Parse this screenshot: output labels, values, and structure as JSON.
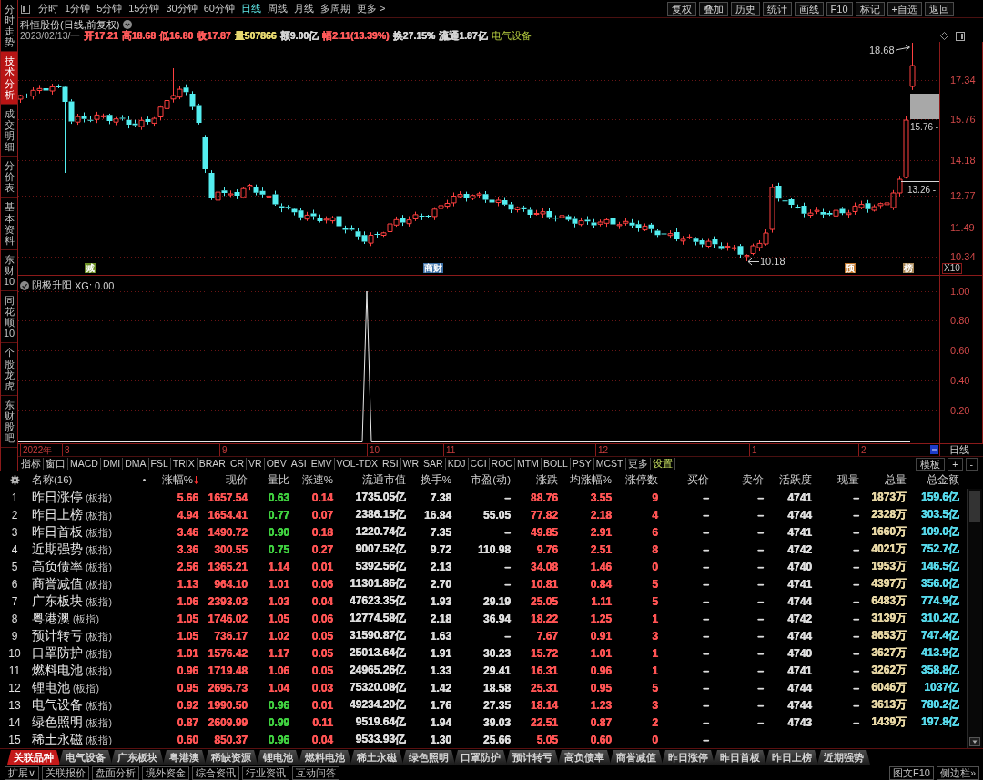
{
  "sidebar": {
    "tabs": [
      {
        "label": "分时走势",
        "selected": false
      },
      {
        "label": "技术分析",
        "selected": true
      },
      {
        "label": "成交明细",
        "selected": false
      },
      {
        "label": "分价表",
        "selected": false
      },
      {
        "label": "基本资料",
        "selected": false
      },
      {
        "label": "东财10",
        "selected": false
      },
      {
        "label": "同花顺10",
        "selected": false
      },
      {
        "label": "个股龙虎",
        "selected": false
      },
      {
        "label": "东财股吧",
        "selected": false
      }
    ]
  },
  "toolbar": {
    "periods": [
      {
        "label": "分时",
        "selected": false
      },
      {
        "label": "1分钟",
        "selected": false
      },
      {
        "label": "5分钟",
        "selected": false
      },
      {
        "label": "15分钟",
        "selected": false
      },
      {
        "label": "30分钟",
        "selected": false
      },
      {
        "label": "60分钟",
        "selected": false
      },
      {
        "label": "日线",
        "selected": true
      },
      {
        "label": "周线",
        "selected": false
      },
      {
        "label": "月线",
        "selected": false
      },
      {
        "label": "多周期",
        "selected": false
      },
      {
        "label": "更多 >",
        "selected": false
      }
    ],
    "actions": [
      "复权",
      "叠加",
      "历史",
      "统计",
      "画线",
      "F10",
      "标记",
      "+自选",
      "返回"
    ]
  },
  "quote": {
    "title": "科恒股份(日线,前复权)",
    "date": "2023/02/13/一",
    "fields": [
      {
        "text": "开17.21",
        "color": "#ff5a5a"
      },
      {
        "text": "高18.68",
        "color": "#ff5a5a"
      },
      {
        "text": "低16.80",
        "color": "#ff5a5a"
      },
      {
        "text": "收17.87",
        "color": "#ff5a5a"
      },
      {
        "text": "量507866",
        "color": "#e6d870"
      },
      {
        "text": "额9.00亿",
        "color": "#d4d4d4"
      },
      {
        "text": "幅2.11(13.39%)",
        "color": "#ff5a5a"
      },
      {
        "text": "换27.15%",
        "color": "#d4d4d4"
      },
      {
        "text": "流通1.87亿",
        "color": "#d4d4d4"
      }
    ],
    "sector": "电气设备"
  },
  "price_chart": {
    "axis_labels": [
      "17.34",
      "15.76",
      "14.18",
      "12.77",
      "11.49",
      "10.34"
    ],
    "annotations": [
      {
        "text": "18.68"
      },
      {
        "text": "15.76 -"
      },
      {
        "text": "13.26 -"
      },
      {
        "text": "10.18"
      }
    ],
    "markers": [
      {
        "text": "减",
        "color": "#6b8e23"
      },
      {
        "text": "商财",
        "color": "#3a6ea5"
      },
      {
        "text": "预",
        "color": "#c0762a"
      },
      {
        "text": "榜",
        "color": "#a88858"
      }
    ],
    "scale_button": "X10"
  },
  "indicator": {
    "title": "阴极升阳",
    "reading": "XG: 0.00",
    "axis_labels": [
      "1.00",
      "0.80",
      "0.60",
      "0.40",
      "0.20"
    ]
  },
  "date_axis": {
    "labels": [
      "2022年",
      "8",
      "9",
      "10",
      "11",
      "12",
      "1",
      "2"
    ],
    "period": "日线"
  },
  "indicator_tabs": {
    "items": [
      "指标",
      "窗口",
      "MACD",
      "DMI",
      "DMA",
      "FSL",
      "TRIX",
      "BRAR",
      "CR",
      "VR",
      "OBV",
      "ASI",
      "EMV",
      "VOL-TDX",
      "RSI",
      "WR",
      "SAR",
      "KDJ",
      "CCI",
      "ROC",
      "MTM",
      "BOLL",
      "PSY",
      "MCST",
      "更多"
    ],
    "settings": "设置",
    "right": [
      "模板",
      "+",
      "-"
    ]
  },
  "table": {
    "name_header": "名称(16)",
    "columns": [
      {
        "label": "涨幅%",
        "color": "#ff5454",
        "sorted": true
      },
      {
        "label": "现价",
        "color": "#ff5454",
        "sorted": false
      },
      {
        "label": "量比",
        "sorted": false
      },
      {
        "label": "涨速%",
        "color": "#ff5454",
        "sorted": false
      },
      {
        "label": "流通市值",
        "color": "#dcdcdc",
        "sorted": false
      },
      {
        "label": "换手%",
        "color": "#dcdcdc",
        "sorted": false
      },
      {
        "label": "市盈(动)",
        "color": "#dcdcdc",
        "sorted": false
      },
      {
        "label": "涨跌",
        "color": "#ff5454",
        "sorted": false
      },
      {
        "label": "均涨幅%",
        "color": "#ff5454",
        "sorted": false
      },
      {
        "label": "涨停数",
        "color": "#ff5454",
        "sorted": false
      },
      {
        "label": "买价",
        "color": "#dcdcdc",
        "sorted": false
      },
      {
        "label": "卖价",
        "color": "#dcdcdc",
        "sorted": false
      },
      {
        "label": "活跃度",
        "color": "#dcdcdc",
        "sorted": false
      },
      {
        "label": "现量",
        "color": "#dcdcdc",
        "sorted": false
      },
      {
        "label": "总量",
        "color": "#e6d6a4",
        "sorted": false
      },
      {
        "label": "总金额",
        "color": "#56d8ea",
        "sorted": false
      }
    ],
    "rows": [
      {
        "index": "1",
        "name": "昨日涨停",
        "tag": "(板指)",
        "cells": [
          "5.66",
          "1657.54",
          {
            "text": "0.63",
            "color": "#40d040"
          },
          "0.14",
          "1735.05亿",
          "7.38",
          "–",
          "88.76",
          "3.55",
          "9",
          "–",
          "–",
          "4741",
          "–",
          "1873万",
          "159.6亿"
        ]
      },
      {
        "index": "2",
        "name": "昨日上榜",
        "tag": "(板指)",
        "cells": [
          "4.94",
          "1654.41",
          {
            "text": "0.77",
            "color": "#40d040"
          },
          "0.07",
          "2386.15亿",
          "16.84",
          "55.05",
          "77.82",
          "2.18",
          "4",
          "–",
          "–",
          "4744",
          "–",
          "2328万",
          "303.5亿"
        ]
      },
      {
        "index": "3",
        "name": "昨日首板",
        "tag": "(板指)",
        "cells": [
          "3.46",
          "1490.72",
          {
            "text": "0.90",
            "color": "#40d040"
          },
          "0.18",
          "1220.74亿",
          "7.35",
          "–",
          "49.85",
          "2.91",
          "6",
          "–",
          "–",
          "4741",
          "–",
          "1660万",
          "109.0亿"
        ]
      },
      {
        "index": "4",
        "name": "近期强势",
        "tag": "(板指)",
        "cells": [
          "3.36",
          "300.55",
          {
            "text": "0.75",
            "color": "#40d040"
          },
          "0.27",
          "9007.52亿",
          "9.72",
          "110.98",
          "9.76",
          "2.51",
          "8",
          "–",
          "–",
          "4742",
          "–",
          "4021万",
          "752.7亿"
        ]
      },
      {
        "index": "5",
        "name": "高负债率",
        "tag": "(板指)",
        "cells": [
          "2.56",
          "1365.21",
          {
            "text": "1.14",
            "color": "#ff5454"
          },
          "0.01",
          "5392.56亿",
          "2.13",
          "–",
          "34.08",
          "1.46",
          "0",
          "–",
          "–",
          "4740",
          "–",
          "1953万",
          "146.5亿"
        ]
      },
      {
        "index": "6",
        "name": "商誉减值",
        "tag": "(板指)",
        "cells": [
          "1.13",
          "964.10",
          {
            "text": "1.01",
            "color": "#ff5454"
          },
          "0.06",
          "11301.86亿",
          "2.70",
          "–",
          "10.81",
          "0.84",
          "5",
          "–",
          "–",
          "4741",
          "–",
          "4397万",
          "356.0亿"
        ]
      },
      {
        "index": "7",
        "name": "广东板块",
        "tag": "(板指)",
        "cells": [
          "1.06",
          "2393.03",
          {
            "text": "1.03",
            "color": "#ff5454"
          },
          "0.04",
          "47623.35亿",
          "1.93",
          "29.19",
          "25.05",
          "1.11",
          "5",
          "–",
          "–",
          "4744",
          "–",
          "6483万",
          "774.9亿"
        ]
      },
      {
        "index": "8",
        "name": "粤港澳",
        "tag": "(板指)",
        "cells": [
          "1.05",
          "1746.02",
          {
            "text": "1.05",
            "color": "#ff5454"
          },
          "0.06",
          "12774.58亿",
          "2.18",
          "36.94",
          "18.22",
          "1.25",
          "1",
          "–",
          "–",
          "4742",
          "–",
          "3139万",
          "310.2亿"
        ]
      },
      {
        "index": "9",
        "name": "预计转亏",
        "tag": "(板指)",
        "cells": [
          "1.05",
          "736.17",
          {
            "text": "1.02",
            "color": "#ff5454"
          },
          "0.05",
          "31590.87亿",
          "1.63",
          "–",
          "7.67",
          "0.91",
          "3",
          "–",
          "–",
          "4744",
          "–",
          "8653万",
          "747.4亿"
        ]
      },
      {
        "index": "10",
        "name": "口罩防护",
        "tag": "(板指)",
        "cells": [
          "1.01",
          "1576.42",
          {
            "text": "1.17",
            "color": "#ff5454"
          },
          "0.05",
          "25013.64亿",
          "1.91",
          "30.23",
          "15.72",
          "1.01",
          "1",
          "–",
          "–",
          "4740",
          "–",
          "3627万",
          "413.9亿"
        ]
      },
      {
        "index": "11",
        "name": "燃料电池",
        "tag": "(板指)",
        "cells": [
          "0.96",
          "1719.48",
          {
            "text": "1.06",
            "color": "#ff5454"
          },
          "0.05",
          "24965.26亿",
          "1.33",
          "29.41",
          "16.31",
          "0.96",
          "1",
          "–",
          "–",
          "4741",
          "–",
          "3262万",
          "358.8亿"
        ]
      },
      {
        "index": "12",
        "name": "锂电池",
        "tag": "(板指)",
        "cells": [
          "0.95",
          "2695.73",
          {
            "text": "1.04",
            "color": "#ff5454"
          },
          "0.03",
          "75320.08亿",
          "1.42",
          "18.58",
          "25.31",
          "0.95",
          "5",
          "–",
          "–",
          "4744",
          "–",
          "6046万",
          "1037亿"
        ]
      },
      {
        "index": "13",
        "name": "电气设备",
        "tag": "(板指)",
        "cells": [
          "0.92",
          "1990.50",
          {
            "text": "0.96",
            "color": "#40d040"
          },
          "0.01",
          "49234.20亿",
          "1.76",
          "27.35",
          "18.14",
          "1.23",
          "3",
          "–",
          "–",
          "4744",
          "–",
          "3613万",
          "780.2亿"
        ]
      },
      {
        "index": "14",
        "name": "绿色照明",
        "tag": "(板指)",
        "cells": [
          "0.87",
          "2609.99",
          {
            "text": "0.99",
            "color": "#40d040"
          },
          "0.11",
          "9519.64亿",
          "1.94",
          "39.03",
          "22.51",
          "0.87",
          "2",
          "–",
          "–",
          "4743",
          "–",
          "1439万",
          "197.8亿"
        ]
      },
      {
        "index": "15",
        "name": "稀土永磁",
        "tag": "(板指)",
        "cells": [
          "0.60",
          "850.37",
          {
            "text": "0.96",
            "color": "#40d040"
          },
          "0.04",
          "9533.93亿",
          "1.30",
          "25.66",
          "5.05",
          "0.60",
          "0",
          "–"
        ]
      }
    ]
  },
  "bottom_tabs": {
    "items": [
      {
        "label": "关联品种",
        "selected": true
      },
      {
        "label": "电气设备",
        "selected": false
      },
      {
        "label": "广东板块",
        "selected": false
      },
      {
        "label": "粤港澳",
        "selected": false
      },
      {
        "label": "稀缺资源",
        "selected": false
      },
      {
        "label": "锂电池",
        "selected": false
      },
      {
        "label": "燃料电池",
        "selected": false
      },
      {
        "label": "稀土永磁",
        "selected": false
      },
      {
        "label": "绿色照明",
        "selected": false
      },
      {
        "label": "口罩防护",
        "selected": false
      },
      {
        "label": "预计转亏",
        "selected": false
      },
      {
        "label": "高负债率",
        "selected": false
      },
      {
        "label": "商誉减值",
        "selected": false
      },
      {
        "label": "昨日涨停",
        "selected": false
      },
      {
        "label": "昨日首板",
        "selected": false
      },
      {
        "label": "昨日上榜",
        "selected": false
      },
      {
        "label": "近期强势",
        "selected": false
      }
    ]
  },
  "footer": {
    "left": [
      "扩展∨",
      "关联报价",
      "盘面分析",
      "境外资金",
      "综合资讯",
      "行业资讯",
      "互动问答"
    ],
    "right": [
      "图文F10",
      "侧边栏»"
    ]
  }
}
